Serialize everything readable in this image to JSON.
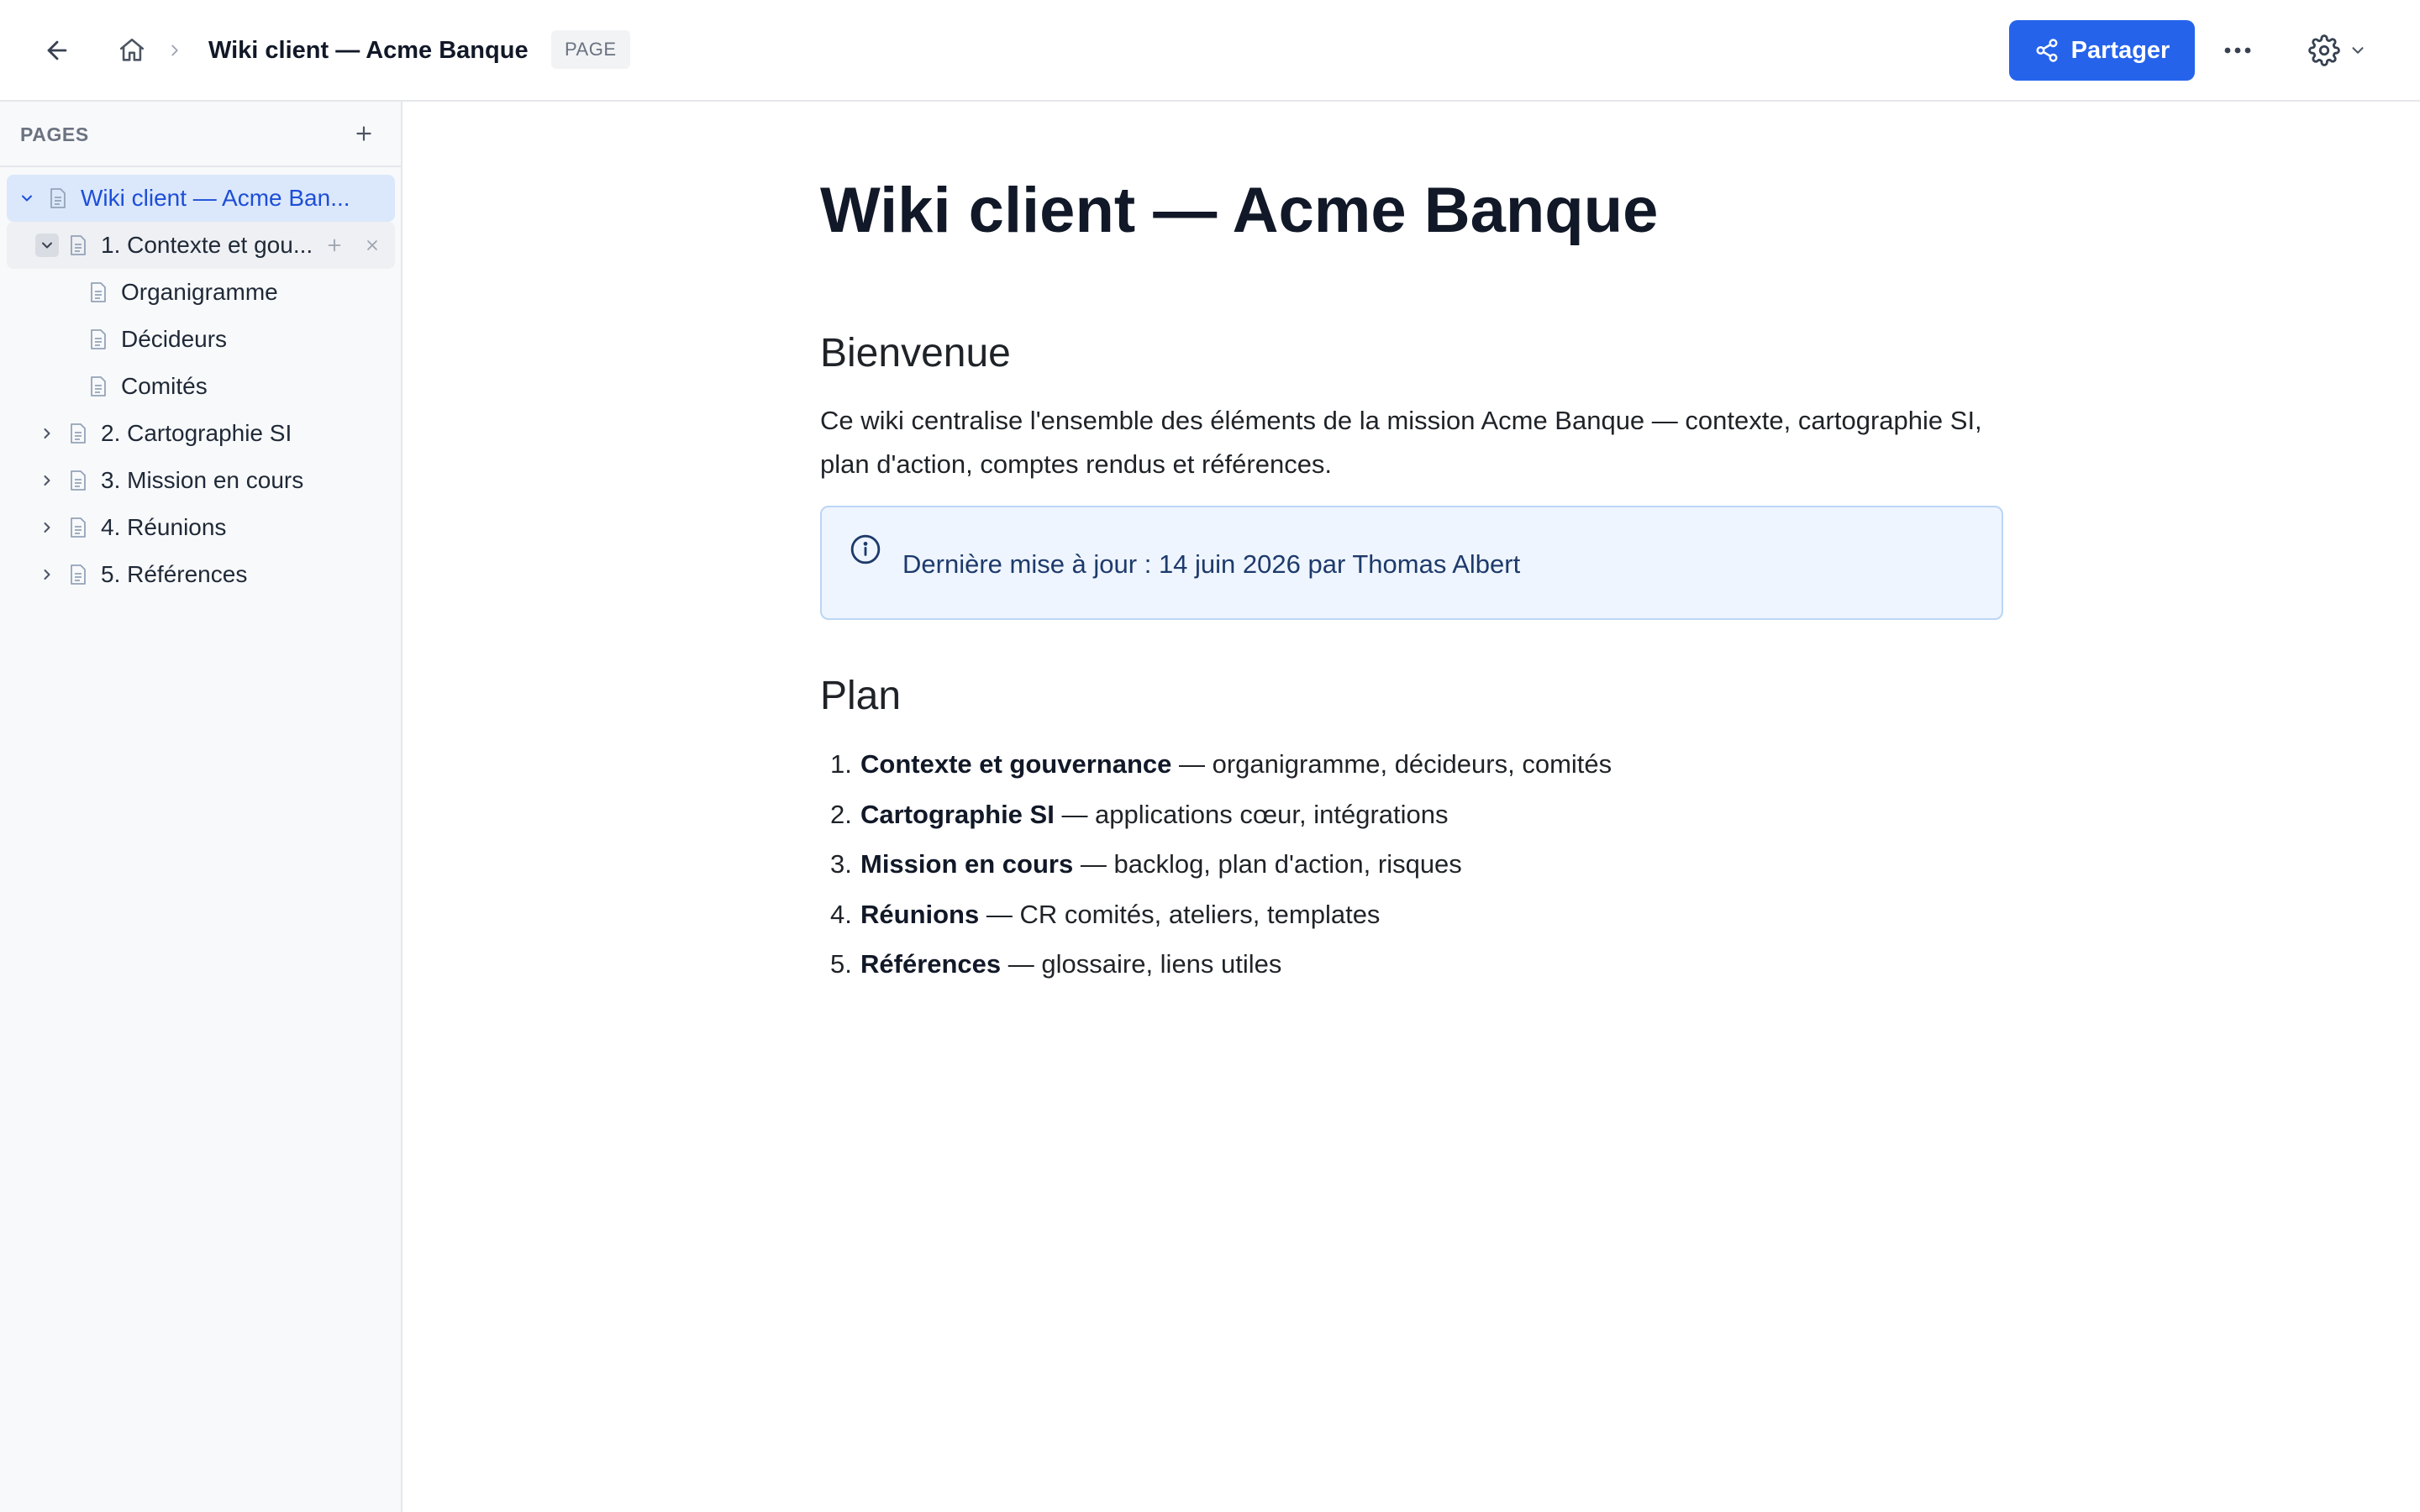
{
  "header": {
    "breadcrumb_title": "Wiki client — Acme Banque",
    "type_badge": "PAGE",
    "share_label": "Partager",
    "accent": "#2563eb"
  },
  "sidebar": {
    "section_label": "PAGES",
    "items": [
      {
        "label": "Wiki client — Acme Ban...",
        "state": "active",
        "expanded": true,
        "depth": 0
      },
      {
        "label": "1. Contexte et gou...",
        "state": "hover",
        "expanded": true,
        "depth": 1
      },
      {
        "label": "Organigramme",
        "depth": 2
      },
      {
        "label": "Décideurs",
        "depth": 2
      },
      {
        "label": "Comités",
        "depth": 2
      },
      {
        "label": "2. Cartographie SI",
        "expanded": false,
        "depth": 1
      },
      {
        "label": "3. Mission en cours",
        "expanded": false,
        "depth": 1
      },
      {
        "label": "4. Réunions",
        "expanded": false,
        "depth": 1
      },
      {
        "label": "5. Références",
        "expanded": false,
        "depth": 1
      }
    ]
  },
  "main": {
    "title": "Wiki client — Acme Banque",
    "welcome_heading": "Bienvenue",
    "welcome_text": "Ce wiki centralise l'ensemble des éléments de la mission Acme Banque — contexte, cartographie SI, plan d'action, comptes rendus et références.",
    "callout_text": "Dernière mise à jour : 14 juin 2026 par Thomas Albert",
    "plan_heading": "Plan",
    "plan": [
      {
        "num": "1.",
        "title": "Contexte et gouvernance",
        "rest": " — organigramme, décideurs, comités"
      },
      {
        "num": "2.",
        "title": "Cartographie SI",
        "rest": " — applications cœur, intégrations"
      },
      {
        "num": "3.",
        "title": "Mission en cours",
        "rest": " — backlog, plan d'action, risques"
      },
      {
        "num": "4.",
        "title": "Réunions",
        "rest": " — CR comités, ateliers, templates"
      },
      {
        "num": "5.",
        "title": "Références",
        "rest": " — glossaire, liens utiles"
      }
    ]
  }
}
